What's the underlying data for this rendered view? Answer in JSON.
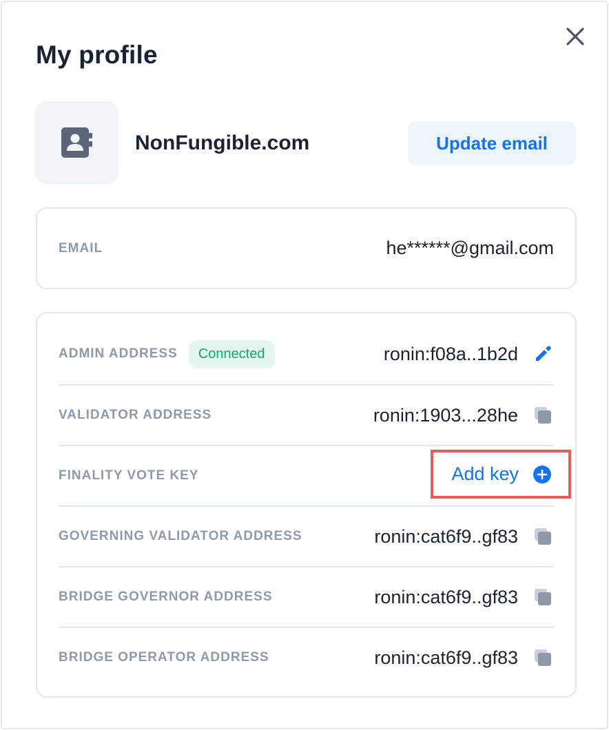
{
  "header": {
    "title": "My profile"
  },
  "profile": {
    "org_name": "NonFungible.com",
    "update_email_label": "Update email"
  },
  "email": {
    "label": "EMAIL",
    "value": "he******@gmail.com"
  },
  "addresses": [
    {
      "label": "ADMIN ADDRESS",
      "badge": "Connected",
      "value": "ronin:f08a..1b2d",
      "icon": "edit-icon"
    },
    {
      "label": "VALIDATOR ADDRESS",
      "value": "ronin:1903...28he",
      "icon": "copy-icon"
    },
    {
      "label": "FINALITY VOTE KEY",
      "action": "Add key",
      "icon": "add-circle-icon"
    },
    {
      "label": "GOVERNING VALIDATOR ADDRESS",
      "value": "ronin:cat6f9..gf83",
      "icon": "copy-icon"
    },
    {
      "label": "BRIDGE GOVERNOR ADDRESS",
      "value": "ronin:cat6f9..gf83",
      "icon": "copy-icon"
    },
    {
      "label": "BRIDGE OPERATOR ADDRESS",
      "value": "ronin:cat6f9..gf83",
      "icon": "copy-icon"
    }
  ],
  "colors": {
    "accent": "#1273ea",
    "success": "#12a873",
    "highlight": "#ee5b56",
    "muted": "#8e99ab"
  }
}
